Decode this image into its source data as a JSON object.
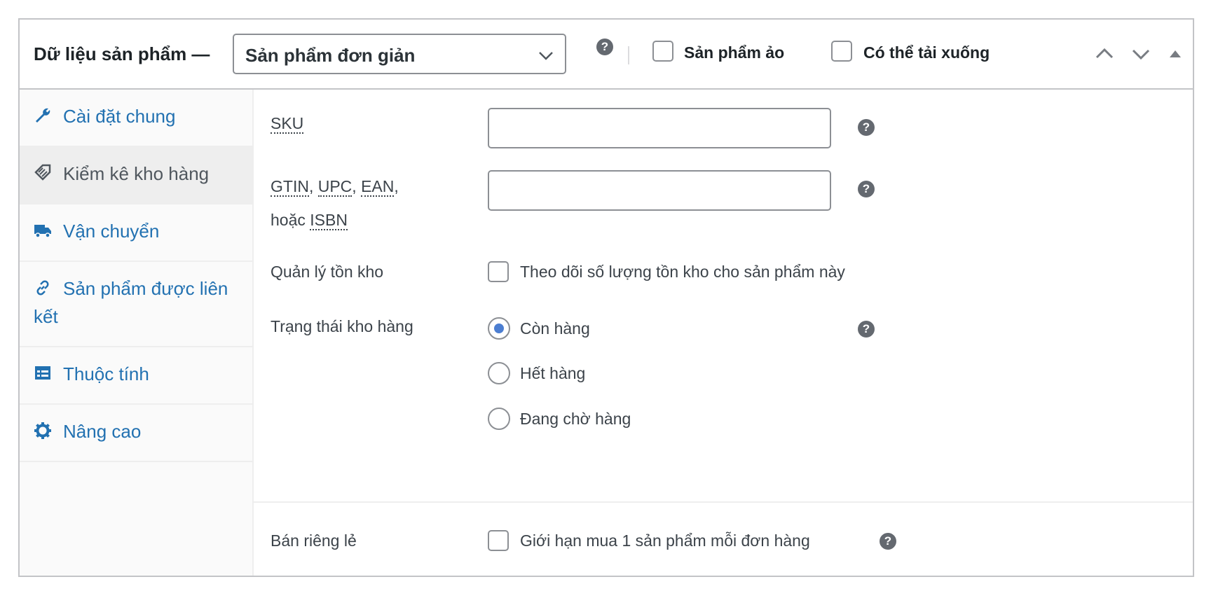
{
  "header": {
    "title": "Dữ liệu sản phẩm —",
    "product_type": "Sản phẩm đơn giản",
    "virtual_label": "Sản phẩm ảo",
    "downloadable_label": "Có thể tải xuống",
    "help_glyph": "?"
  },
  "sidebar": {
    "tabs": [
      {
        "label": "Cài đặt chung",
        "icon": "wrench-icon",
        "active": false
      },
      {
        "label": "Kiểm kê kho hàng",
        "icon": "tag-icon",
        "active": true
      },
      {
        "label": "Vận chuyển",
        "icon": "truck-icon",
        "active": false
      },
      {
        "label": "Sản phẩm được liên kết",
        "icon": "link-icon",
        "active": false
      },
      {
        "label": "Thuộc tính",
        "icon": "list-table-icon",
        "active": false
      },
      {
        "label": "Nâng cao",
        "icon": "gear-icon",
        "active": false
      }
    ]
  },
  "inventory": {
    "sku": {
      "label": "SKU",
      "value": ""
    },
    "gtin": {
      "abbr_gtin": "GTIN",
      "abbr_upc": "UPC",
      "abbr_ean": "EAN",
      "sep": ", ",
      "trail": ",",
      "or_text": "hoặc ",
      "abbr_isbn": "ISBN",
      "value": ""
    },
    "manage_stock": {
      "label": "Quản lý tồn kho",
      "checkbox_label": "Theo dõi số lượng tồn kho cho sản phẩm này",
      "checked": false
    },
    "stock_status": {
      "label": "Trạng thái kho hàng",
      "options": [
        {
          "label": "Còn hàng",
          "checked": true
        },
        {
          "label": "Hết hàng",
          "checked": false
        },
        {
          "label": "Đang chờ hàng",
          "checked": false
        }
      ]
    },
    "sold_individually": {
      "label": "Bán riêng lẻ",
      "checkbox_label": "Giới hạn mua 1 sản phẩm mỗi đơn hàng",
      "checked": false
    }
  },
  "colors": {
    "link": "#2271b1",
    "radio_accent": "#4c7ed1",
    "border": "#c3c4c7",
    "help_icon": "#646970"
  }
}
